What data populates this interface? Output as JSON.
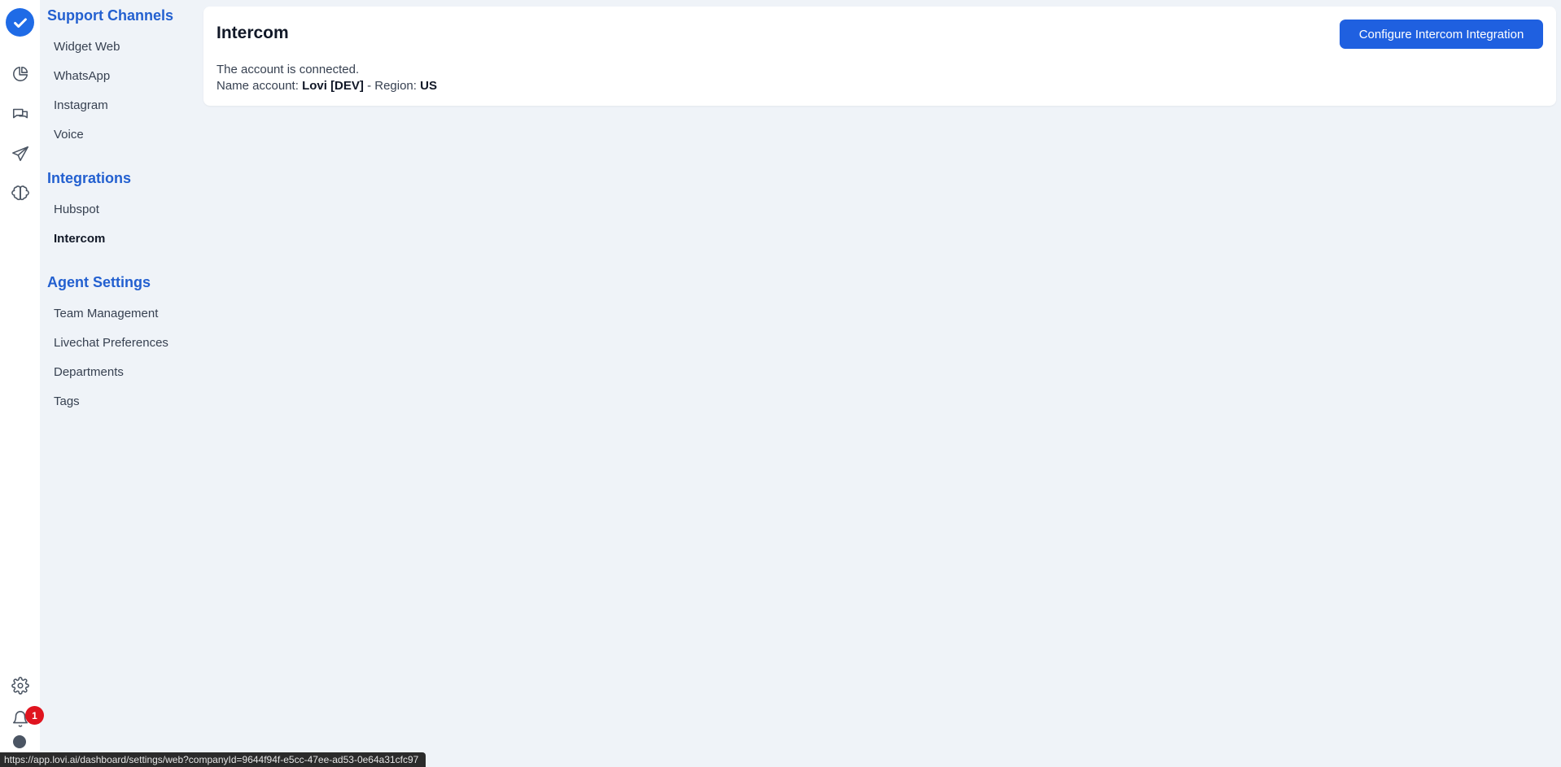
{
  "rail": {
    "notification_count": "1"
  },
  "sidenav": {
    "sections": [
      {
        "title": "Support Channels",
        "items": [
          "Widget Web",
          "WhatsApp",
          "Instagram",
          "Voice"
        ]
      },
      {
        "title": "Integrations",
        "items": [
          "Hubspot",
          "Intercom"
        ]
      },
      {
        "title": "Agent Settings",
        "items": [
          "Team Management",
          "Livechat Preferences",
          "Departments",
          "Tags"
        ]
      }
    ],
    "active_item": "Intercom"
  },
  "main": {
    "title": "Intercom",
    "configure_button": "Configure Intercom Integration",
    "status_text": "The account is connected.",
    "name_label": "Name account:",
    "name_value": "Lovi [DEV]",
    "separator": "- Region:",
    "region_value": "US"
  },
  "statusbar": {
    "url": "https://app.lovi.ai/dashboard/settings/web?companyId=9644f94f-e5cc-47ee-ad53-0e64a31cfc97"
  },
  "colors": {
    "accent": "#1f60e0",
    "section_title": "#2360d0",
    "background": "#eff3f8",
    "badge": "#e0141f"
  }
}
